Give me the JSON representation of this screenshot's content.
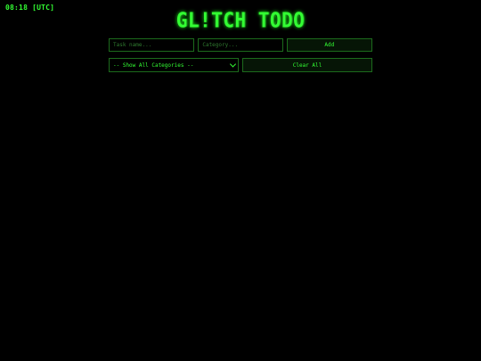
{
  "clock": "08:18 [UTC]",
  "title": "GL!TCH TODO",
  "form": {
    "task_placeholder": "Task name...",
    "category_placeholder": "Category...",
    "add_label": "Add"
  },
  "filter": {
    "selected": "-- Show All Categories --",
    "clear_label": "Clear All"
  },
  "icons": {
    "select_arrow": "chevron-down-icon"
  },
  "colors": {
    "background": "#000000",
    "accent": "#33ff33",
    "border": "#1c6b1c"
  }
}
